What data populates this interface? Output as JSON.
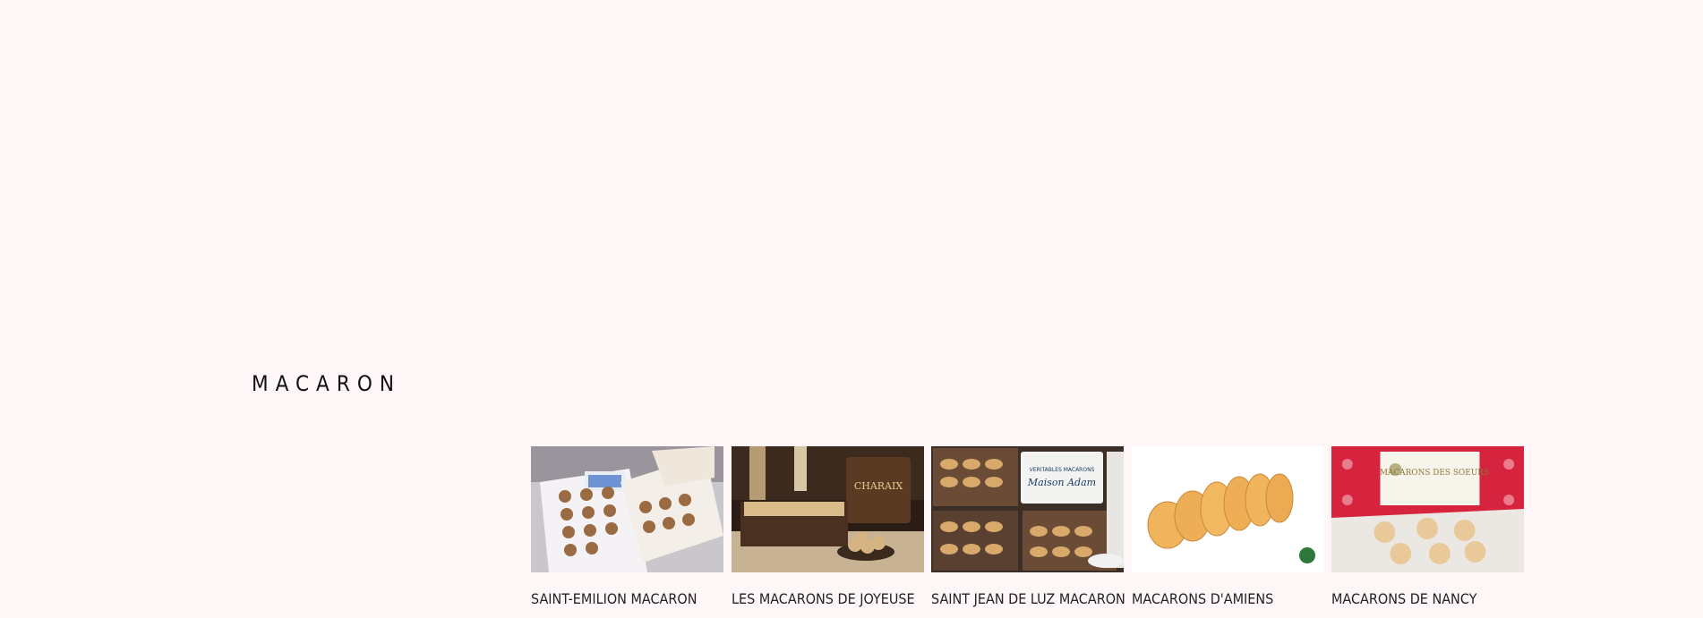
{
  "section": {
    "title": "MACARON"
  },
  "products": [
    {
      "label": "SAINT-EMILION MACARON",
      "image_icon": "saint-emilion-macaron-box-photo"
    },
    {
      "label": "LES MACARONS DE JOYEUSE",
      "image_icon": "joyeuse-macarons-tin-photo"
    },
    {
      "label": "SAINT JEAN DE LUZ MACARON",
      "image_icon": "maison-adam-macaron-trays-photo"
    },
    {
      "label": "MACARONS D'AMIENS",
      "image_icon": "amiens-macarons-row-photo"
    },
    {
      "label": "MACARONS DE NANCY",
      "image_icon": "nancy-macarons-des-soeurs-photo"
    }
  ],
  "image_text": {
    "joyeuse_tin": "CHARAIX",
    "adam_tin_top": "VERITABLES MACARONS",
    "adam_tin_brand": "Maison Adam",
    "nancy_box": "MACARONS DES SOEURS"
  },
  "colors": {
    "background": "#fff6f7",
    "text": "#111111"
  }
}
